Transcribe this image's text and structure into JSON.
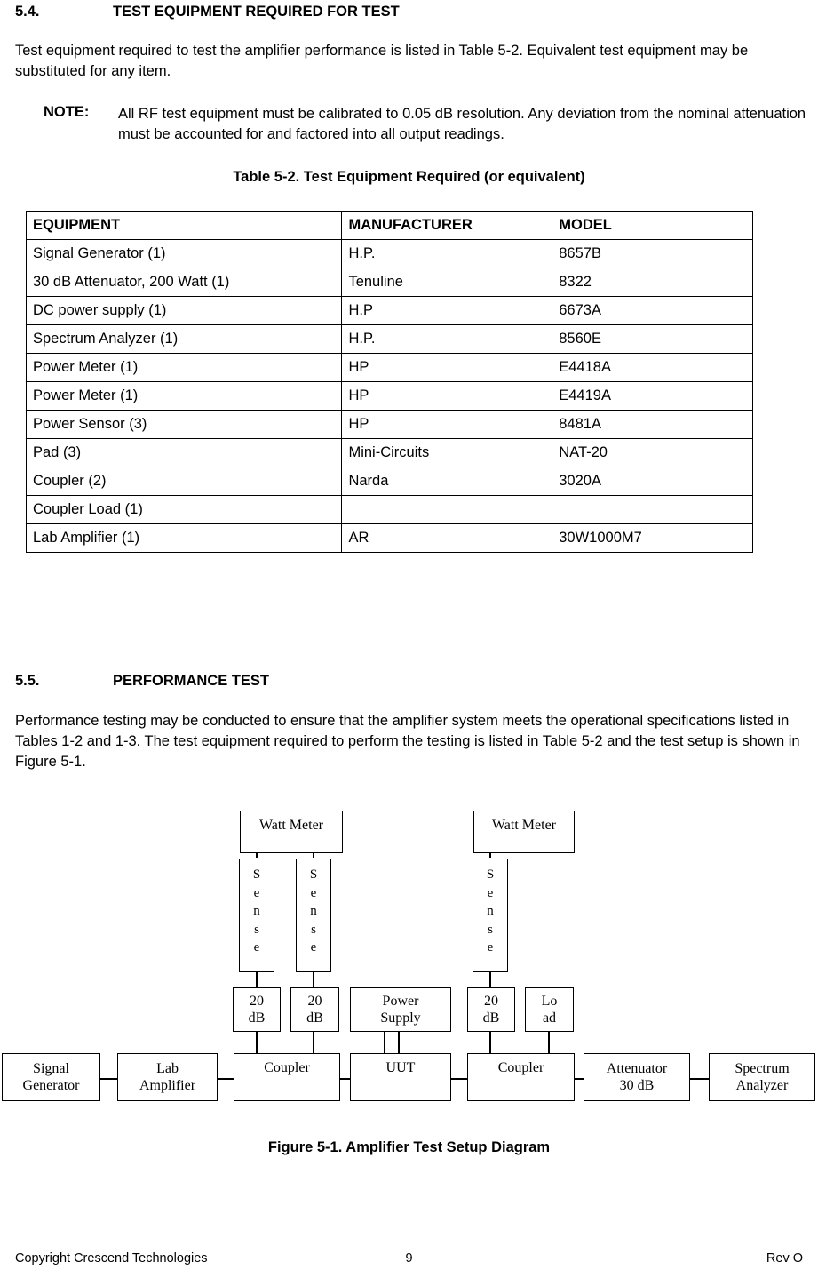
{
  "sections": [
    {
      "number": "5.4.",
      "title": "TEST EQUIPMENT REQUIRED FOR TEST"
    },
    {
      "number": "5.5.",
      "title": "PERFORMANCE TEST"
    }
  ],
  "paragraphs": {
    "p1": "Test equipment required to test the amplifier performance is listed in Table 5-2. Equivalent test equipment may be substituted for any item.",
    "p2": "Performance testing may be conducted to ensure that the amplifier system meets the operational specifications listed in Tables 1-2 and 1-3.  The test equipment required to perform the testing is listed in Table 5-2 and the test setup is shown in Figure 5-1."
  },
  "note": {
    "label": "NOTE:",
    "text": "All RF test equipment must be calibrated to 0.05 dB resolution. Any deviation from the nominal attenuation must be accounted for and factored into all output readings."
  },
  "table": {
    "caption": "Table 5-2. Test Equipment Required (or equivalent)",
    "headers": [
      "EQUIPMENT",
      "MANUFACTURER",
      "MODEL"
    ],
    "rows": [
      [
        "Signal Generator (1)",
        "H.P.",
        "8657B"
      ],
      [
        "30 dB Attenuator, 200 Watt (1)",
        "Tenuline",
        "8322"
      ],
      [
        "DC power supply (1)",
        "H.P",
        "6673A"
      ],
      [
        "Spectrum Analyzer (1)",
        "H.P.",
        "8560E"
      ],
      [
        "Power Meter (1)",
        "HP",
        "E4418A"
      ],
      [
        "Power Meter (1)",
        "HP",
        "E4419A"
      ],
      [
        "Power Sensor (3)",
        "HP",
        "8481A"
      ],
      [
        "Pad (3)",
        "Mini-Circuits",
        "NAT-20"
      ],
      [
        "Coupler (2)",
        "Narda",
        "3020A"
      ],
      [
        "Coupler Load (1)",
        "",
        ""
      ],
      [
        "Lab Amplifier (1)",
        "AR",
        "30W1000M7"
      ]
    ]
  },
  "figure": {
    "caption": "Figure 5-1. Amplifier Test Setup Diagram",
    "blocks": {
      "watt_meter_left": "Watt Meter",
      "watt_meter_right": "Watt Meter",
      "sense_1": "Sense",
      "sense_2": "Sense",
      "sense_3": "Sense",
      "atten_20db_1_line1": "20",
      "atten_20db_1_line2": "dB",
      "atten_20db_2_line1": "20",
      "atten_20db_2_line2": "dB",
      "atten_20db_3_line1": "20",
      "atten_20db_3_line2": "dB",
      "power_supply_line1": "Power",
      "power_supply_line2": "Supply",
      "load_line1": "Lo",
      "load_line2": "ad",
      "signal_generator_line1": "Signal",
      "signal_generator_line2": "Generator",
      "lab_amplifier_line1": "Lab",
      "lab_amplifier_line2": "Amplifier",
      "coupler_left": "Coupler",
      "uut": "UUT",
      "coupler_right": "Coupler",
      "attenuator_line1": "Attenuator",
      "attenuator_line2": "30 dB",
      "spectrum_analyzer_line1": "Spectrum",
      "spectrum_analyzer_line2": "Analyzer"
    }
  },
  "footer": {
    "left": "Copyright Crescend Technologies",
    "page": "9",
    "right": "Rev O"
  }
}
